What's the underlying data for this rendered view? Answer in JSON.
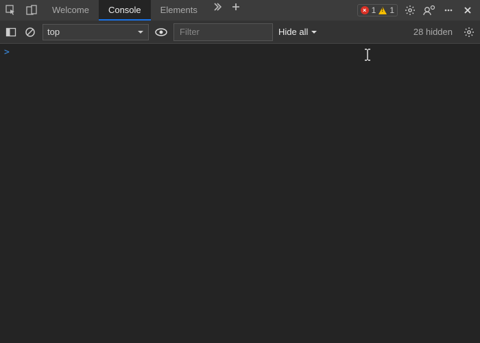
{
  "tabs": {
    "welcome": "Welcome",
    "console": "Console",
    "elements": "Elements"
  },
  "badges": {
    "errors": "1",
    "warnings": "1"
  },
  "toolbar": {
    "context": "top",
    "filter_placeholder": "Filter",
    "level": "Hide all",
    "hidden_count": "28 hidden"
  },
  "console": {
    "prompt": ">"
  }
}
